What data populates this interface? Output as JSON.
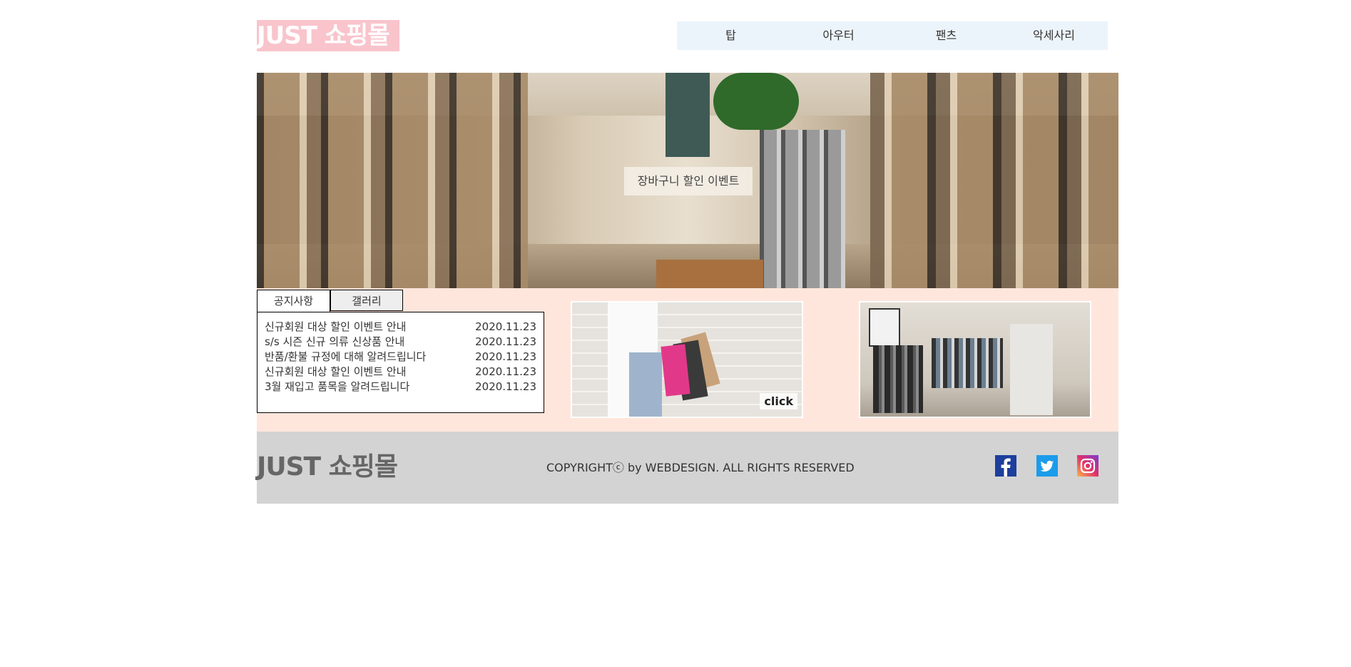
{
  "header": {
    "logo": "JUST 쇼핑몰",
    "nav": [
      "탑",
      "아우터",
      "팬츠",
      "악세사리"
    ]
  },
  "banner": {
    "label": "장바구니 할인 이벤트"
  },
  "notice": {
    "tabs": [
      "공지사항",
      "갤러리"
    ],
    "items": [
      {
        "title": "신규회원 대상 할인 이벤트 안내",
        "date": "2020.11.23"
      },
      {
        "title": "s/s 시즌 신규 의류 신상품 안내",
        "date": "2020.11.23"
      },
      {
        "title": "반품/환불 규정에 대해 알려드립니다",
        "date": "2020.11.23"
      },
      {
        "title": "신규회원 대상 할인 이벤트 안내",
        "date": "2020.11.23"
      },
      {
        "title": "3월 재입고 품목을 알려드립니다",
        "date": "2020.11.23"
      }
    ]
  },
  "gallery": {
    "click_label": "click"
  },
  "footer": {
    "logo": "JUST 쇼핑몰",
    "copyright": "COPYRIGHTⓒ by WEBDESIGN. ALL RIGHTS RESERVED",
    "sns": [
      "facebook-icon",
      "twitter-icon",
      "instagram-icon"
    ]
  },
  "colors": {
    "logo_bg": "#f9c4cc",
    "nav_bg": "#ecf4fb",
    "content_bg": "#ffe6dc",
    "footer_bg": "#d3d3d3"
  }
}
